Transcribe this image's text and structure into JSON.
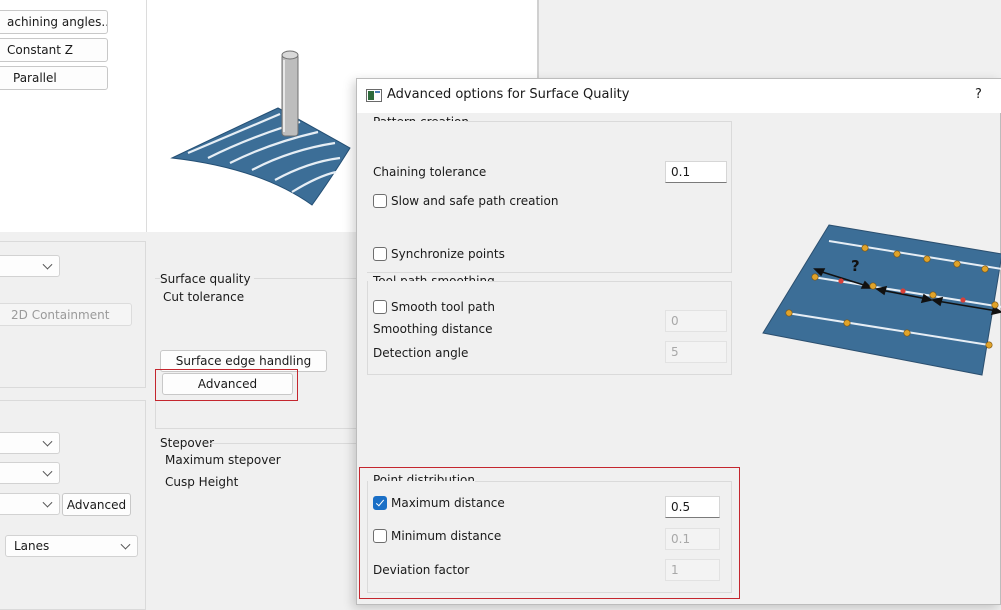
{
  "left_panel": {
    "machining_angles_label": "achining angles...",
    "constant_z_label": "Constant Z",
    "parallel_label": "Parallel",
    "containment_label": "2D Containment",
    "advanced_label": "Advanced",
    "lanes_value": "Lanes"
  },
  "middle_panel": {
    "surface_quality_label": "Surface quality",
    "cut_tolerance_label": "Cut tolerance",
    "surface_edge_button": "Surface edge handling",
    "advanced_button": "Advanced",
    "stepover_label": "Stepover",
    "maximum_stepover_label": "Maximum stepover",
    "cusp_height_label": "Cusp Height"
  },
  "dialog": {
    "title": "Advanced options for Surface Quality",
    "help_label": "?",
    "pattern_creation": {
      "title": "Pattern creation",
      "chaining_tolerance_label": "Chaining tolerance",
      "chaining_tolerance_value": "0.1",
      "slow_safe_label": "Slow and safe path creation",
      "slow_safe_checked": false,
      "synchronize_label": "Synchronize points",
      "synchronize_checked": false
    },
    "smoothing": {
      "title": "Tool path smoothing",
      "smooth_label": "Smooth tool path",
      "smooth_checked": false,
      "smoothing_distance_label": "Smoothing distance",
      "smoothing_distance_value": "0",
      "detection_angle_label": "Detection angle",
      "detection_angle_value": "5"
    },
    "point_distribution": {
      "title": "Point distribution",
      "max_distance_label": "Maximum distance",
      "max_distance_checked": true,
      "max_distance_value": "0.5",
      "min_distance_label": "Minimum distance",
      "min_distance_checked": false,
      "min_distance_value": "0.1",
      "deviation_factor_label": "Deviation factor",
      "deviation_factor_value": "1"
    },
    "illustration_question": "?"
  },
  "colors": {
    "surface_blue": "#3c6e97",
    "highlight_red": "#c4262e",
    "check_blue": "#1a6fc6",
    "point_orange": "#e0a32a",
    "point_red": "#d9413a"
  }
}
